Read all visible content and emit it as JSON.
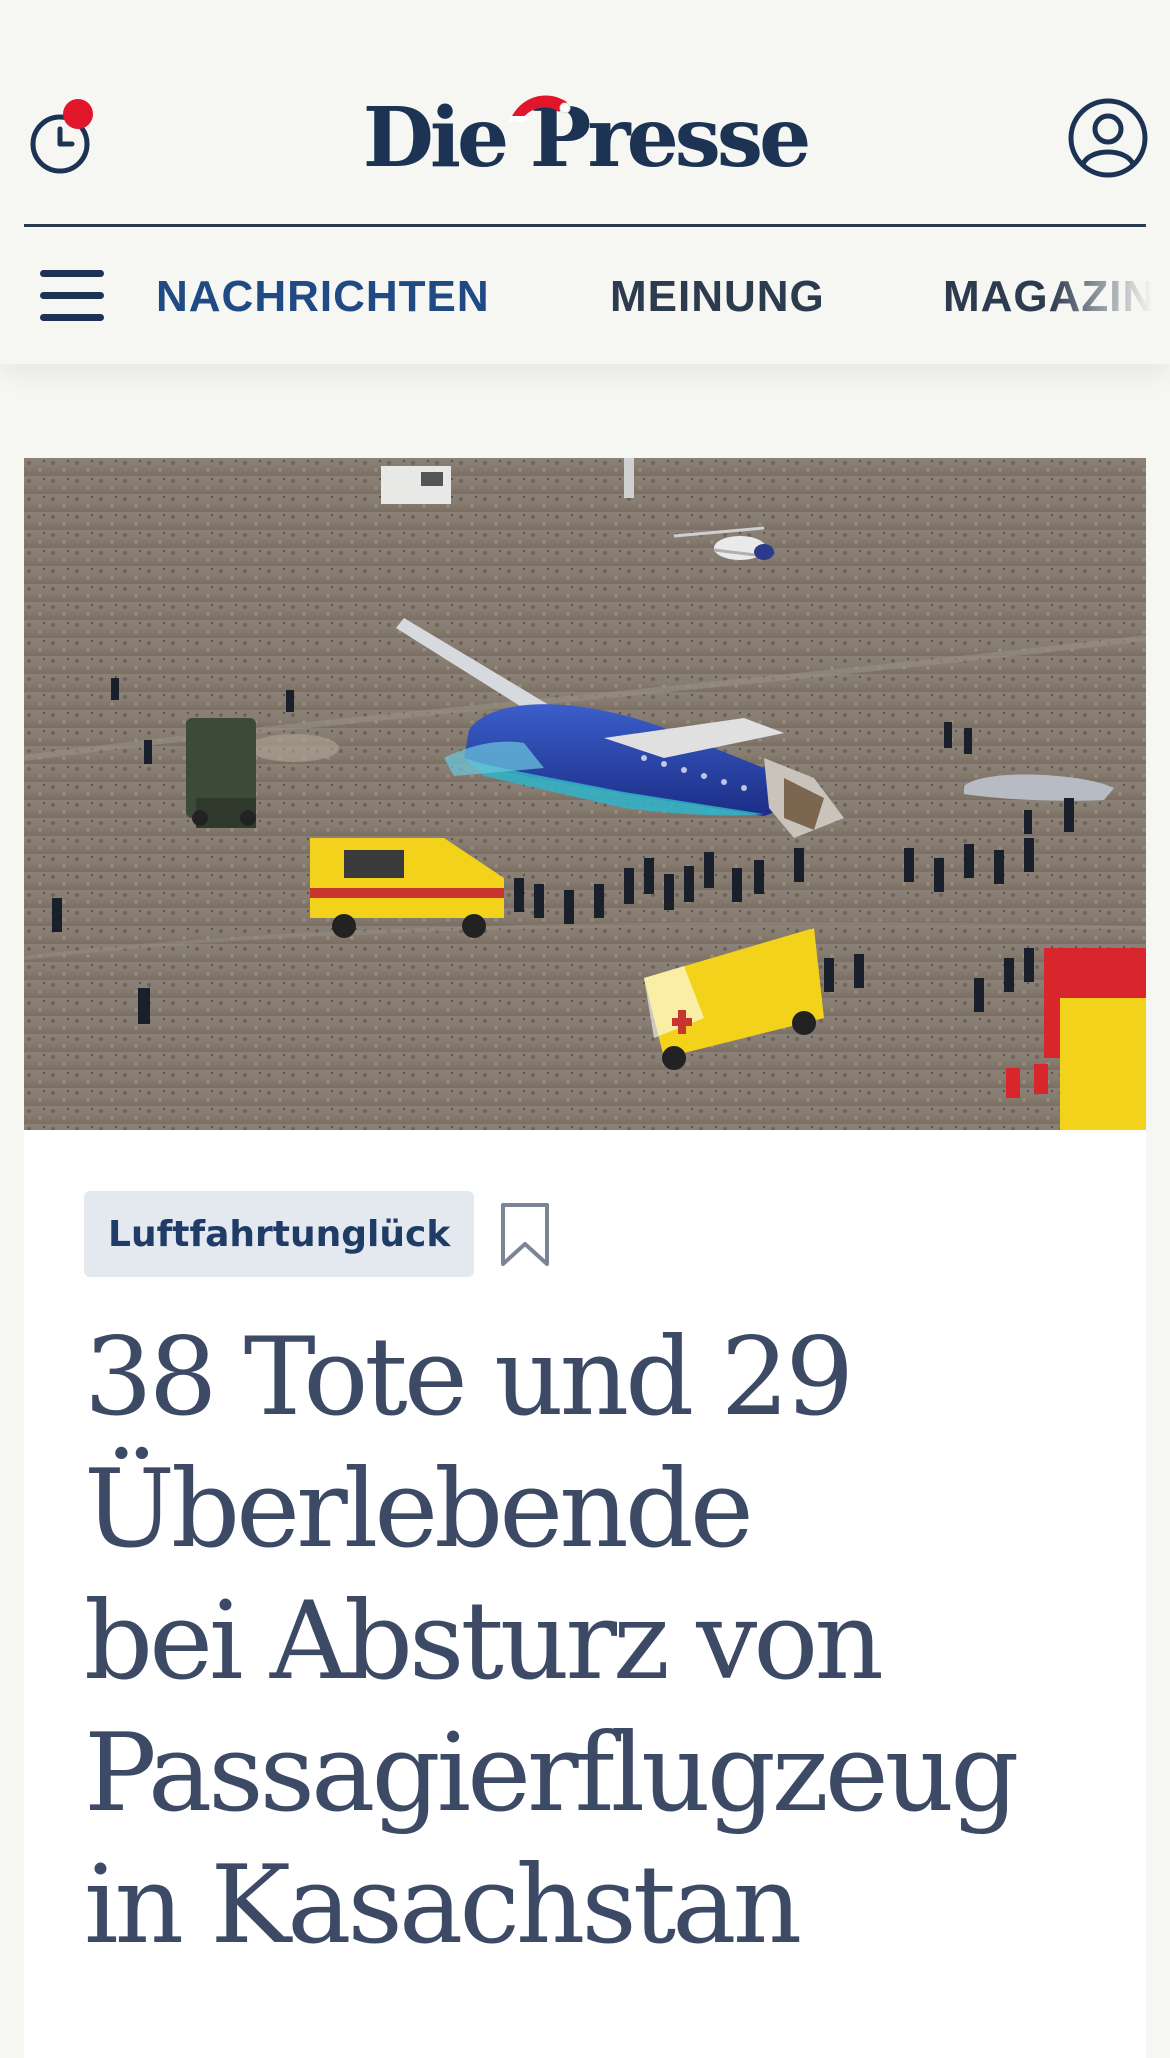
{
  "header": {
    "logo_text": "Die Presse",
    "recent_icon": "clock-icon",
    "recent_badge_color": "#e2162b",
    "account_icon": "user-circle-icon"
  },
  "nav": {
    "menu_icon": "hamburger-menu-icon",
    "items": [
      {
        "label": "NACHRICHTEN",
        "active": true
      },
      {
        "label": "MEINUNG",
        "active": false
      },
      {
        "label": "MAGAZIN",
        "active": false
      }
    ],
    "active_color": "#1f4a84"
  },
  "article": {
    "image_alt": "Luftaufnahme eines abgestürzten Passagierflugzeugs in einer Steppe mit Rettungsfahrzeugen und Einsatzkräften",
    "tag": "Luftfahrtunglück",
    "bookmark_icon": "bookmark-icon",
    "headline_lines": [
      "38 Tote und 29",
      "Überlebende",
      "bei Absturz von",
      "Passagierflugzeug",
      "in Kasachstan"
    ]
  }
}
